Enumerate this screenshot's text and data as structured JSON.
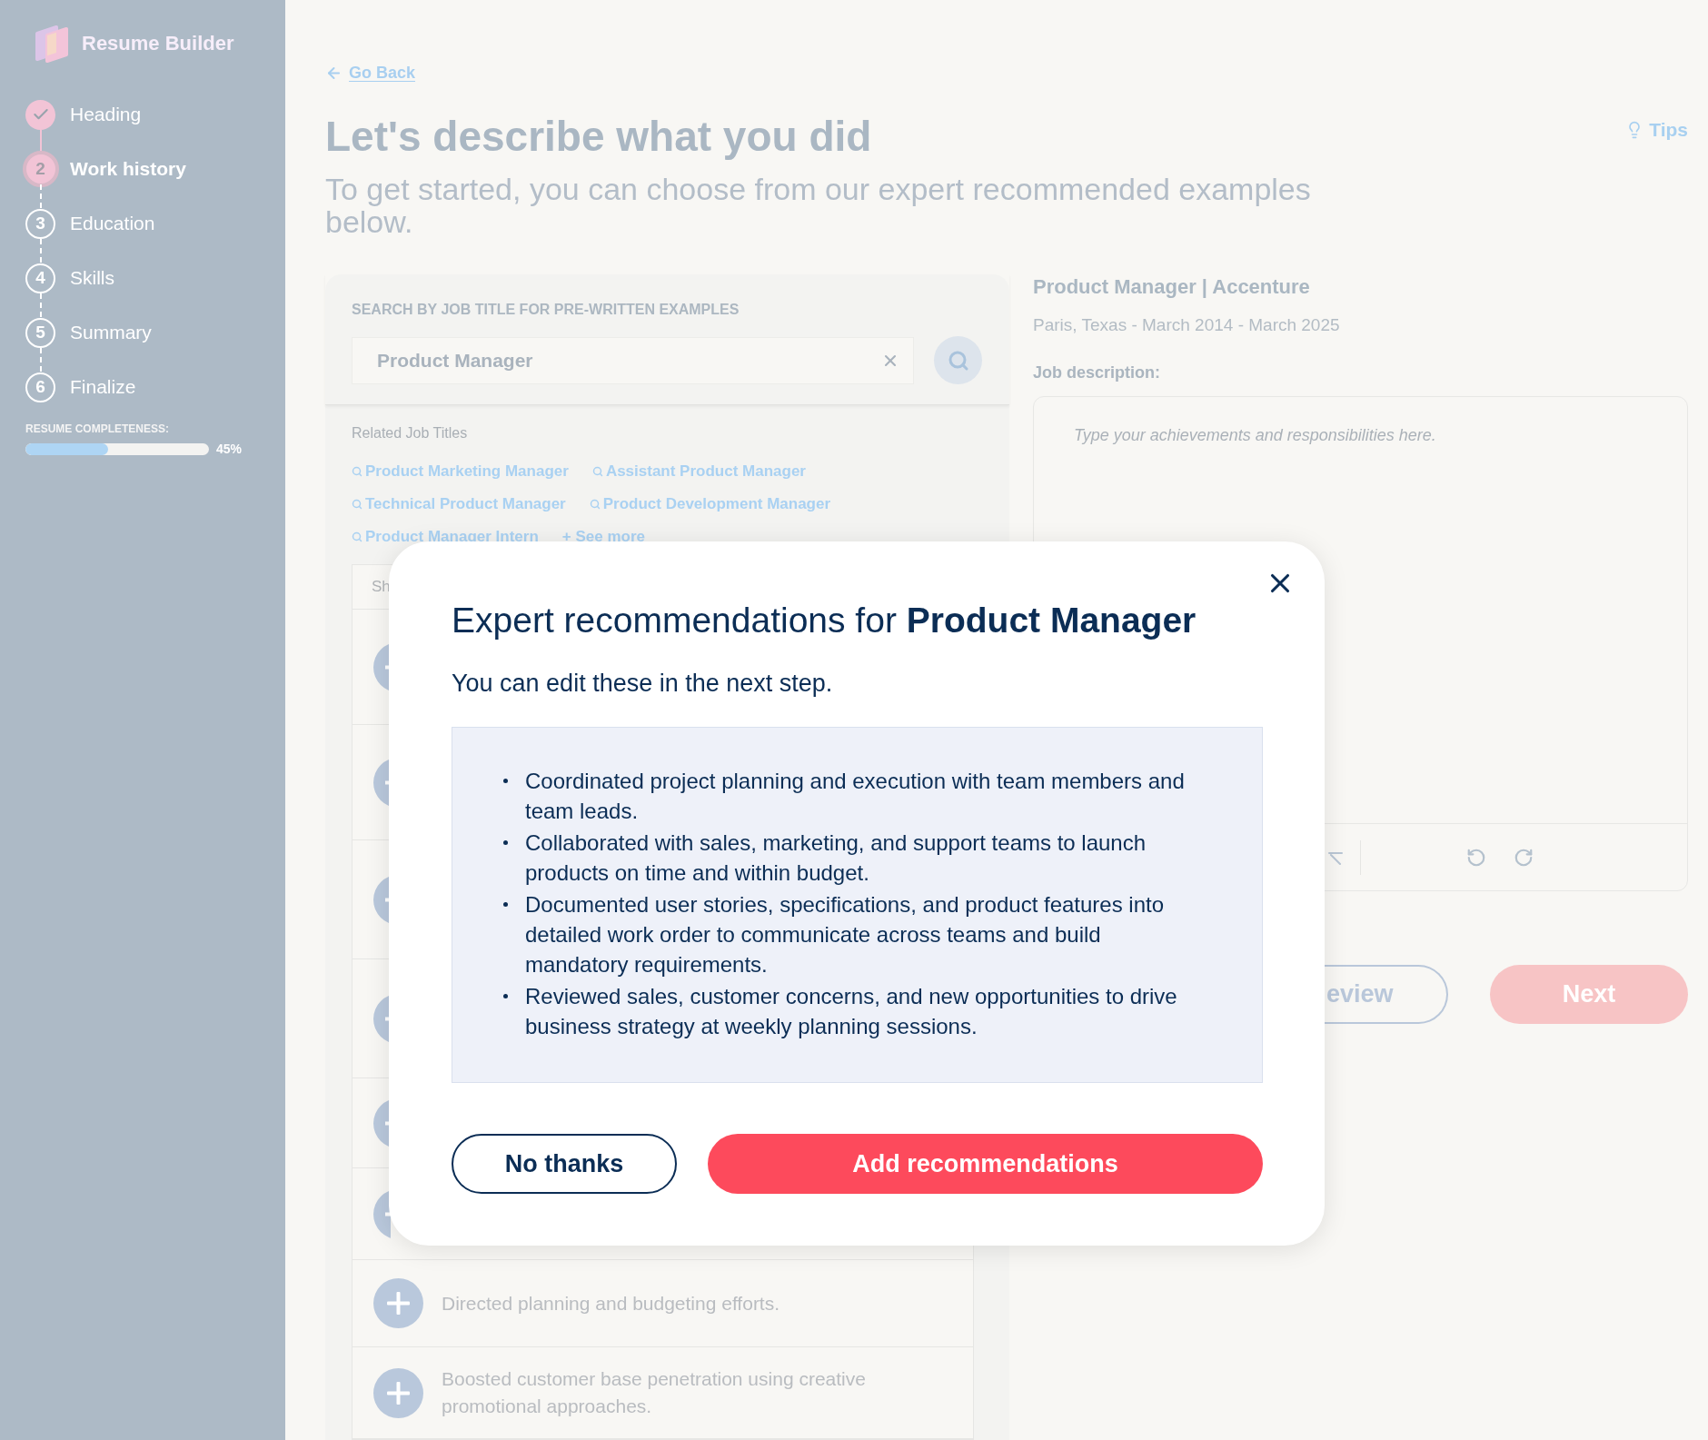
{
  "sidebar": {
    "logo": "Resume Builder",
    "steps": [
      {
        "label": "Heading",
        "completed": true,
        "selected": false
      },
      {
        "number": "2",
        "label": "Work history",
        "completed": false,
        "selected": true
      },
      {
        "number": "3",
        "label": "Education",
        "completed": false,
        "selected": false
      },
      {
        "number": "4",
        "label": "Skills",
        "completed": false,
        "selected": false
      },
      {
        "number": "5",
        "label": "Summary",
        "completed": false,
        "selected": false
      },
      {
        "number": "6",
        "label": "Finalize",
        "completed": false,
        "selected": false
      }
    ],
    "completeness": {
      "label": "RESUME COMPLETENESS:",
      "level": 0.45,
      "reading": "45%"
    }
  },
  "header": {
    "back_link": "Go Back",
    "title": "Let's describe what you did",
    "subtitle": "To get started, you can choose from our expert recommended examples below.",
    "tips": "Tips"
  },
  "search_panel": {
    "heading": "SEARCH BY JOB TITLE FOR PRE-WRITTEN EXAMPLES",
    "search": {
      "value": "Product Manager"
    },
    "related_heading": "Related Job Titles",
    "related_titles": [
      {
        "kind": "title",
        "label": "Product Marketing Manager"
      },
      {
        "kind": "title",
        "label": "Assistant Product Manager"
      },
      {
        "kind": "title",
        "label": "Technical Product Manager"
      },
      {
        "kind": "title",
        "label": "Product Development Manager"
      },
      {
        "kind": "title",
        "label": "Product Manager Intern"
      },
      {
        "kind": "more",
        "label": "+ See more"
      }
    ],
    "examples": {
      "header": "Sh",
      "rows": [
        {
          "kind": "covered"
        },
        {
          "kind": "covered"
        },
        {
          "kind": "covered"
        },
        {
          "kind": "covered"
        },
        {
          "kind": "covered"
        },
        {
          "kind": "covered"
        },
        {
          "kind": "example",
          "text": "Directed planning and budgeting efforts."
        },
        {
          "kind": "example",
          "text": "Boosted customer base penetration using creative promotional approaches."
        }
      ]
    }
  },
  "job": {
    "title": "Product Manager | Accenture",
    "details": "Paris, Texas - March 2014 - March 2025",
    "description_label": "Job description:",
    "description": {
      "placeholder": "Type your achievements and responsibilities here."
    }
  },
  "actions": {
    "preview": "eview",
    "next": "Next"
  },
  "modal": {
    "title": "Expert recommendations for **Product Manager**",
    "subtitle": "You can edit these in the next step.",
    "recommendations": [
      "Coordinated project planning and execution with team members and team leads.",
      "Collaborated with sales, marketing, and support teams to launch products on time and within budget.",
      "Documented user stories, specifications, and product features into detailed work order to communicate across teams and build mandatory requirements.",
      "Reviewed sales, customer concerns, and new opportunities to drive business strategy at weekly planning sessions."
    ],
    "buttons": {
      "decline": "No thanks",
      "accept": "Add recommendations"
    }
  }
}
